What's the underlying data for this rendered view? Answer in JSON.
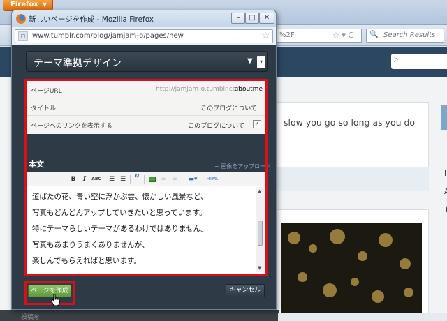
{
  "browser": {
    "menu_label": "Firefox",
    "url_fragment": "%2F",
    "search_placeholder": "Search Results"
  },
  "background": {
    "card_text": "slow you go so long as you do",
    "right_text": [
      "I",
      "A",
      "T"
    ],
    "bottom_text": "投稿を"
  },
  "popup": {
    "window_title": "新しいページを作成 - Mozilla Firefox",
    "url": "www.tumblr.com/blog/jamjam-o/pages/new",
    "theme_title": "テーマ準拠デザイン",
    "settings": {
      "url_label": "ページURL",
      "url_prefix": "http://jamjam-o.tumblr.com/",
      "url_slug": "aboutme",
      "title_label": "タイトル",
      "title_value": "このブログについて",
      "link_label": "ページへのリンクを表示する",
      "link_value": "このブログについて",
      "link_checked": true
    },
    "body_label": "本文",
    "upload_link": "+ 画像をアップロード",
    "toolbar": {
      "bold": "B",
      "italic": "I",
      "strike": "ABC",
      "bullet_list": "☰",
      "numbered_list": "☰",
      "quote": "“",
      "html": "HTML"
    },
    "body_lines": [
      "道ばたの花、青い空に浮かぶ雲、懐かしい風景など、",
      "写真もどんどんアップしていきたいと思っています。",
      "特にテーマらしいテーマがあるわけではありません。",
      "写真もあまりうまくありませんが、",
      "楽しんでもらえればと思います。"
    ],
    "create_button": "ページを作成",
    "cancel_button": "キャンセル"
  },
  "colors": {
    "highlight_red": "#d8101a",
    "create_green": "#6ea84a",
    "dashboard_navy": "#2c4762",
    "panel_dark": "#2e3a46"
  },
  "icons": [
    "firefox-logo-icon",
    "minimize-icon",
    "maximize-icon",
    "close-icon",
    "site-identity-icon",
    "bookmark-star-icon",
    "search-icon",
    "dropdown-arrow-icon",
    "checkbox-icon",
    "pointer-cursor-icon"
  ]
}
